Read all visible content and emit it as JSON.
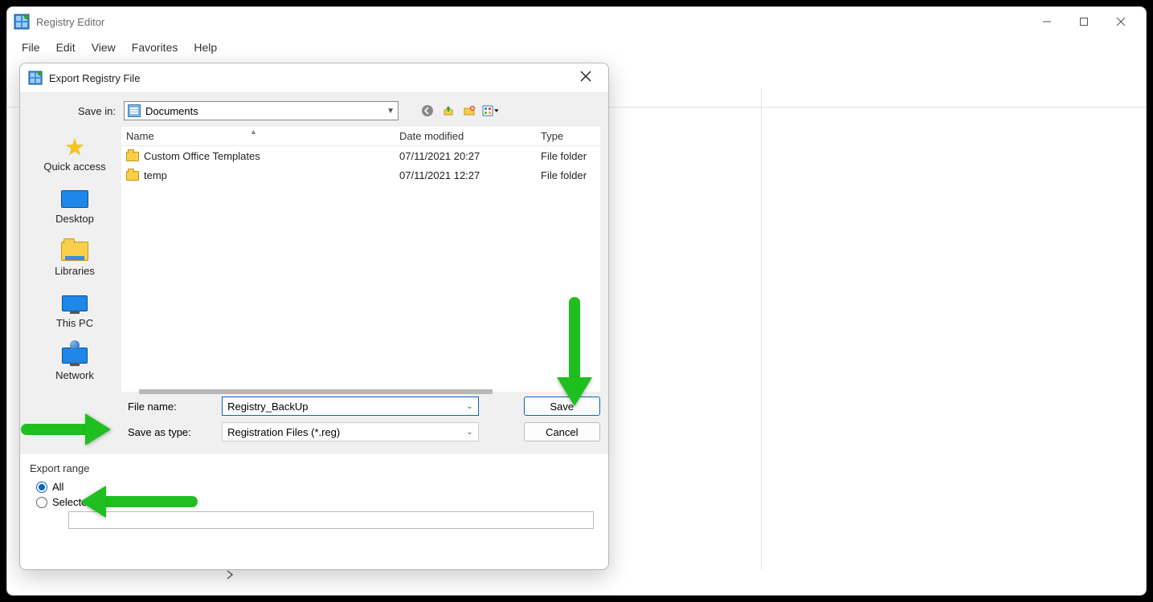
{
  "main": {
    "title": "Registry Editor",
    "menu": [
      "File",
      "Edit",
      "View",
      "Favorites",
      "Help"
    ]
  },
  "dialog": {
    "title": "Export Registry File",
    "save_in_label": "Save in:",
    "save_in_value": "Documents",
    "places": [
      {
        "label": "Quick access"
      },
      {
        "label": "Desktop"
      },
      {
        "label": "Libraries"
      },
      {
        "label": "This PC"
      },
      {
        "label": "Network"
      }
    ],
    "columns": {
      "name": "Name",
      "date": "Date modified",
      "type": "Type"
    },
    "rows": [
      {
        "name": "Custom Office Templates",
        "date": "07/11/2021 20:27",
        "type": "File folder"
      },
      {
        "name": "temp",
        "date": "07/11/2021 12:27",
        "type": "File folder"
      }
    ],
    "file_name_label": "File name:",
    "file_name_value": "Registry_BackUp",
    "save_type_label": "Save as type:",
    "save_type_value": "Registration Files (*.reg)",
    "save_btn": "Save",
    "cancel_btn": "Cancel",
    "export_range": {
      "title": "Export range",
      "all": "All",
      "selected": "Selected branch"
    }
  }
}
